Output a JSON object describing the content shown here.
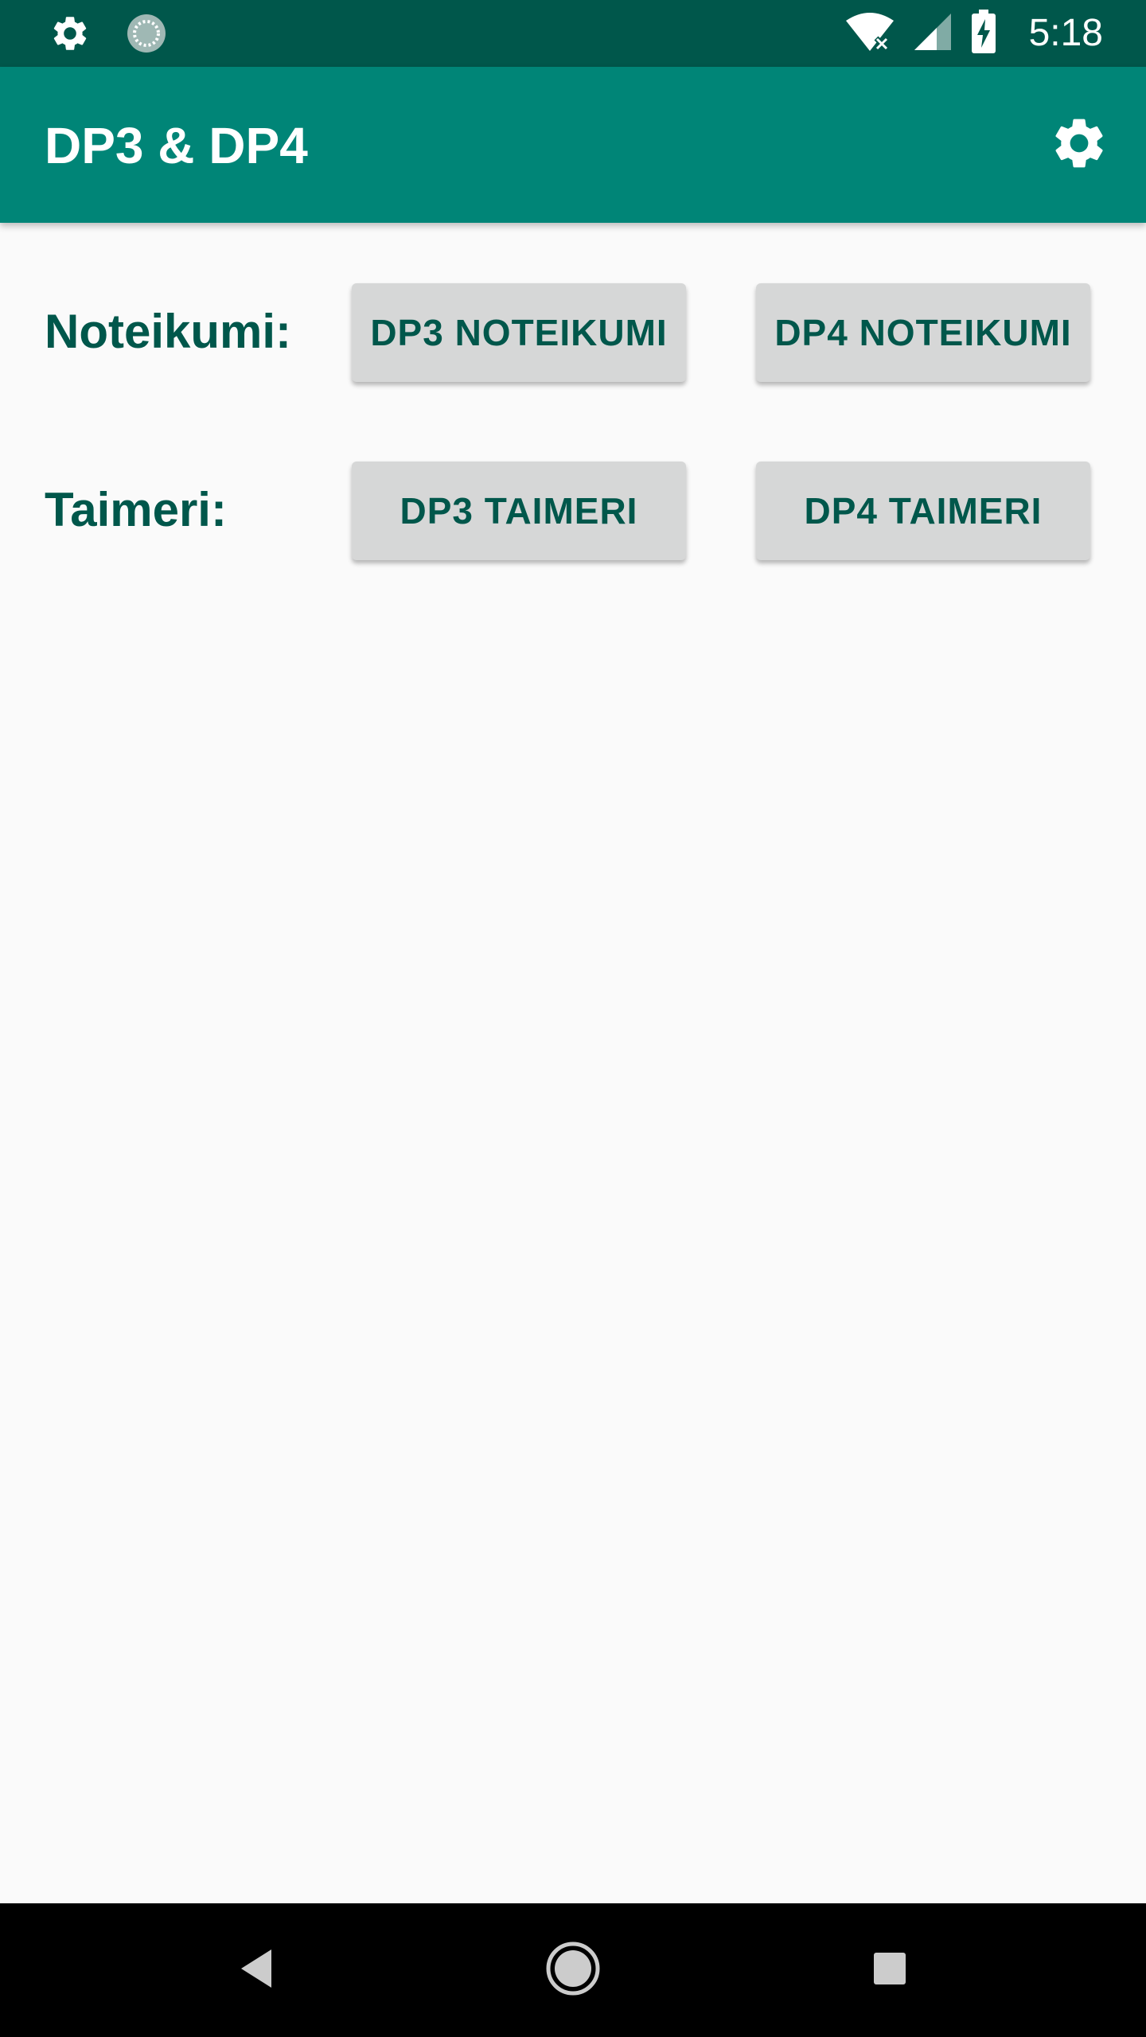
{
  "status_bar": {
    "time": "5:18",
    "icons": [
      "gear-icon",
      "sync-icon",
      "wifi-icon",
      "signal-icon",
      "battery-icon"
    ]
  },
  "app_bar": {
    "title": "DP3 & DP4",
    "action_icon": "gear-icon"
  },
  "rows": [
    {
      "label": "Noteikumi:",
      "buttons": [
        "DP3 NOTEIKUMI",
        "DP4 NOTEIKUMI"
      ]
    },
    {
      "label": "Taimeri:",
      "buttons": [
        "DP3 TAIMERI",
        "DP4 TAIMERI"
      ]
    }
  ],
  "nav_bar": {
    "icons": [
      "back-icon",
      "home-icon",
      "recents-icon"
    ]
  },
  "colors": {
    "status_bar": "#00574b",
    "app_bar": "#008577",
    "accent_text": "#00574b",
    "button_bg": "#d6d7d7",
    "background": "#fafafa",
    "nav_bar": "#000000"
  }
}
